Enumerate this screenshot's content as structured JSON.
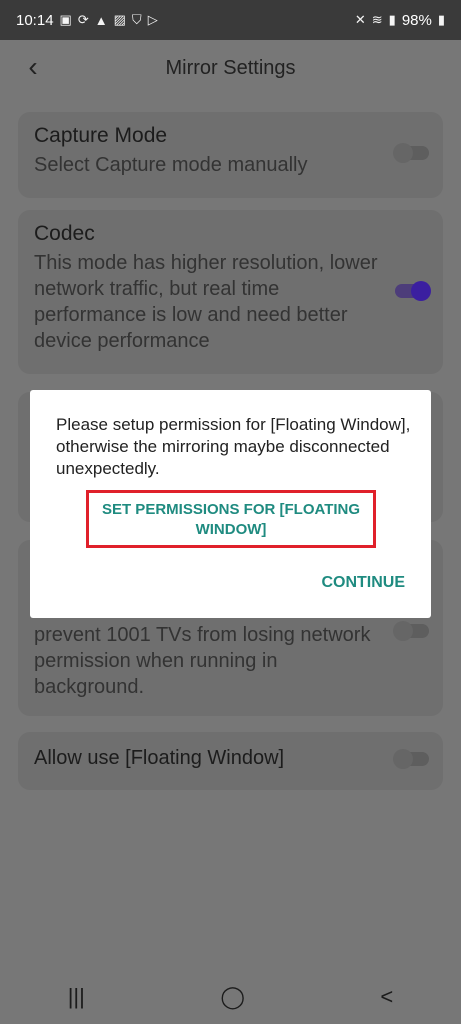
{
  "status_bar": {
    "time": "10:14",
    "battery": "98%",
    "left_icons": [
      "bag-icon",
      "sync-icon",
      "warning-icon",
      "image-icon",
      "shield-icon",
      "play-icon"
    ],
    "right_icons": [
      "mute-icon",
      "wifi-icon",
      "signal-icon",
      "battery-icon"
    ]
  },
  "header": {
    "title": "Mirror Settings"
  },
  "cards": [
    {
      "title": "Capture Mode",
      "subtitle": "Select Capture mode manually",
      "toggle_on": false
    },
    {
      "title": "Codec",
      "subtitle": "This mode has higher resolution, lower network traffic, but real time performance is low and need better device performance",
      "toggle_on": true
    },
    {
      "title": "",
      "subtitle": "prevent 1001 TVs from losing network permission when running in background.",
      "toggle_on": false
    },
    {
      "title": "Allow use [Floating Window]",
      "subtitle": "",
      "toggle_on": false
    }
  ],
  "dialog": {
    "message": "Please setup permission for [Floating Window], otherwise the mirroring maybe disconnected unexpectedly.",
    "set_permissions_label": "SET PERMISSIONS FOR [FLOATING WINDOW]",
    "continue_label": "CONTINUE",
    "accent_color": "#1f8b80",
    "highlight_color": "#e0202a"
  },
  "nav": {
    "recents_glyph": "|||",
    "home_glyph": "◯",
    "back_glyph": "<"
  }
}
